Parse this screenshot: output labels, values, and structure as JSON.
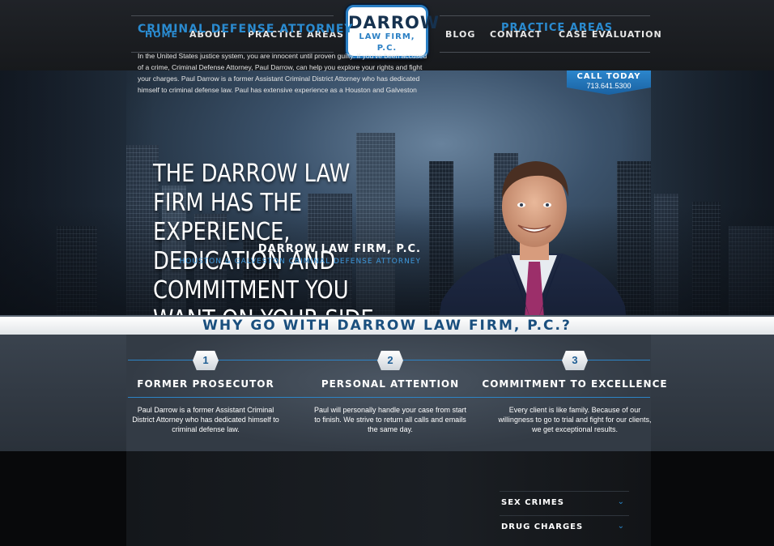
{
  "nav": {
    "home": "HOME",
    "about": "ABOUT",
    "practice_areas": "PRACTICE AREAS",
    "blog": "BLOG",
    "contact": "CONTACT",
    "case_evaluation": "CASE EVALUATION"
  },
  "logo": {
    "line1": "DARROW",
    "line2": "LAW FIRM, P.C."
  },
  "call": {
    "label": "CALL TODAY",
    "phone": "713.641.5300"
  },
  "hero": {
    "headline": "THE DARROW LAW FIRM HAS THE EXPERIENCE, DEDICATION AND COMMITMENT YOU WANT ON YOUR SIDE.",
    "firm_name": "DARROW LAW FIRM, P.C.",
    "tagline": "HOUSTON & GALVESTON CRIMINAL DEFENSE ATTORNEY"
  },
  "why": {
    "title": "WHY GO WITH DARROW LAW FIRM, P.C.?"
  },
  "features": [
    {
      "num": "1",
      "title": "FORMER PROSECUTOR",
      "text": "Paul Darrow is a former Assistant Criminal District Attorney who has dedicated himself to criminal defense law."
    },
    {
      "num": "2",
      "title": "PERSONAL ATTENTION",
      "text": "Paul will personally handle your case from start to finish. We strive to return all calls and emails the same day."
    },
    {
      "num": "3",
      "title": "COMMITMENT TO EXCELLENCE",
      "text": "Every client is like family. Because of our willingness to go to trial and fight for our clients, we get exceptional results."
    }
  ],
  "content": {
    "title": "CRIMINAL DEFENSE ATTORNEY",
    "body": "In the United States justice system, you are innocent until proven guilty.  If you've been accused of a crime, Criminal Defense Attorney, Paul Darrow, can help you explore your rights and fight your charges.  Paul Darrow is a former Assistant Criminal District Attorney who has dedicated himself to criminal defense law.  Paul has extensive experience as a Houston and Galveston"
  },
  "practice_areas": {
    "title": "PRACTICE AREAS",
    "items": [
      {
        "label": "SEX CRIMES"
      },
      {
        "label": "DRUG CHARGES"
      }
    ]
  },
  "colors": {
    "accent": "#2a8bd0",
    "navy": "#1a4f7e",
    "background": "#0b0c0e"
  }
}
